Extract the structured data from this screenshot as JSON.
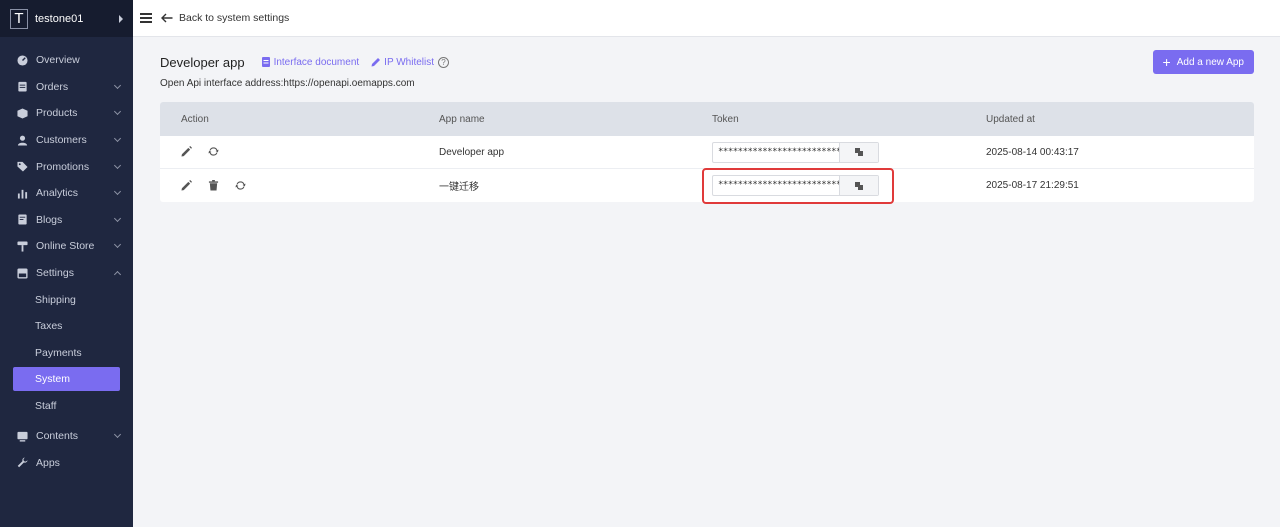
{
  "sidebar": {
    "store_initial": "T",
    "store_name": "testone01",
    "items": [
      {
        "label": "Overview",
        "icon": "gauge-icon"
      },
      {
        "label": "Orders",
        "icon": "clipboard-icon"
      },
      {
        "label": "Products",
        "icon": "box-icon"
      },
      {
        "label": "Customers",
        "icon": "user-icon"
      },
      {
        "label": "Promotions",
        "icon": "tag-icon"
      },
      {
        "label": "Analytics",
        "icon": "bar-chart-icon"
      },
      {
        "label": "Blogs",
        "icon": "document-icon"
      },
      {
        "label": "Online Store",
        "icon": "paint-roller-icon"
      },
      {
        "label": "Settings",
        "icon": "settings-icon"
      }
    ],
    "settings_sub": [
      "Shipping",
      "Taxes",
      "Payments",
      "System",
      "Staff"
    ],
    "bottom_items": [
      {
        "label": "Contents",
        "icon": "monitor-icon"
      },
      {
        "label": "Apps",
        "icon": "wrench-icon"
      }
    ]
  },
  "topbar": {
    "back_label": "Back to system settings"
  },
  "page": {
    "title": "Developer app",
    "interface_doc": "Interface document",
    "ip_whitelist": "IP Whitelist",
    "help": "?",
    "add_button": "Add a new App",
    "api_address": "Open Api interface address:https://openapi.oemapps.com"
  },
  "table": {
    "headers": {
      "action": "Action",
      "app_name": "App name",
      "token": "Token",
      "updated_at": "Updated at"
    },
    "rows": [
      {
        "app_name": "Developer app",
        "token": "*************************************",
        "updated_at": "2025-08-14 00:43:17"
      },
      {
        "app_name": "一键迁移",
        "token": "*************************************",
        "updated_at": "2025-08-17 21:29:51"
      }
    ]
  },
  "colors": {
    "accent": "#7a6cf0",
    "sidebar": "#1f2740",
    "highlight": "#e03a3a"
  }
}
